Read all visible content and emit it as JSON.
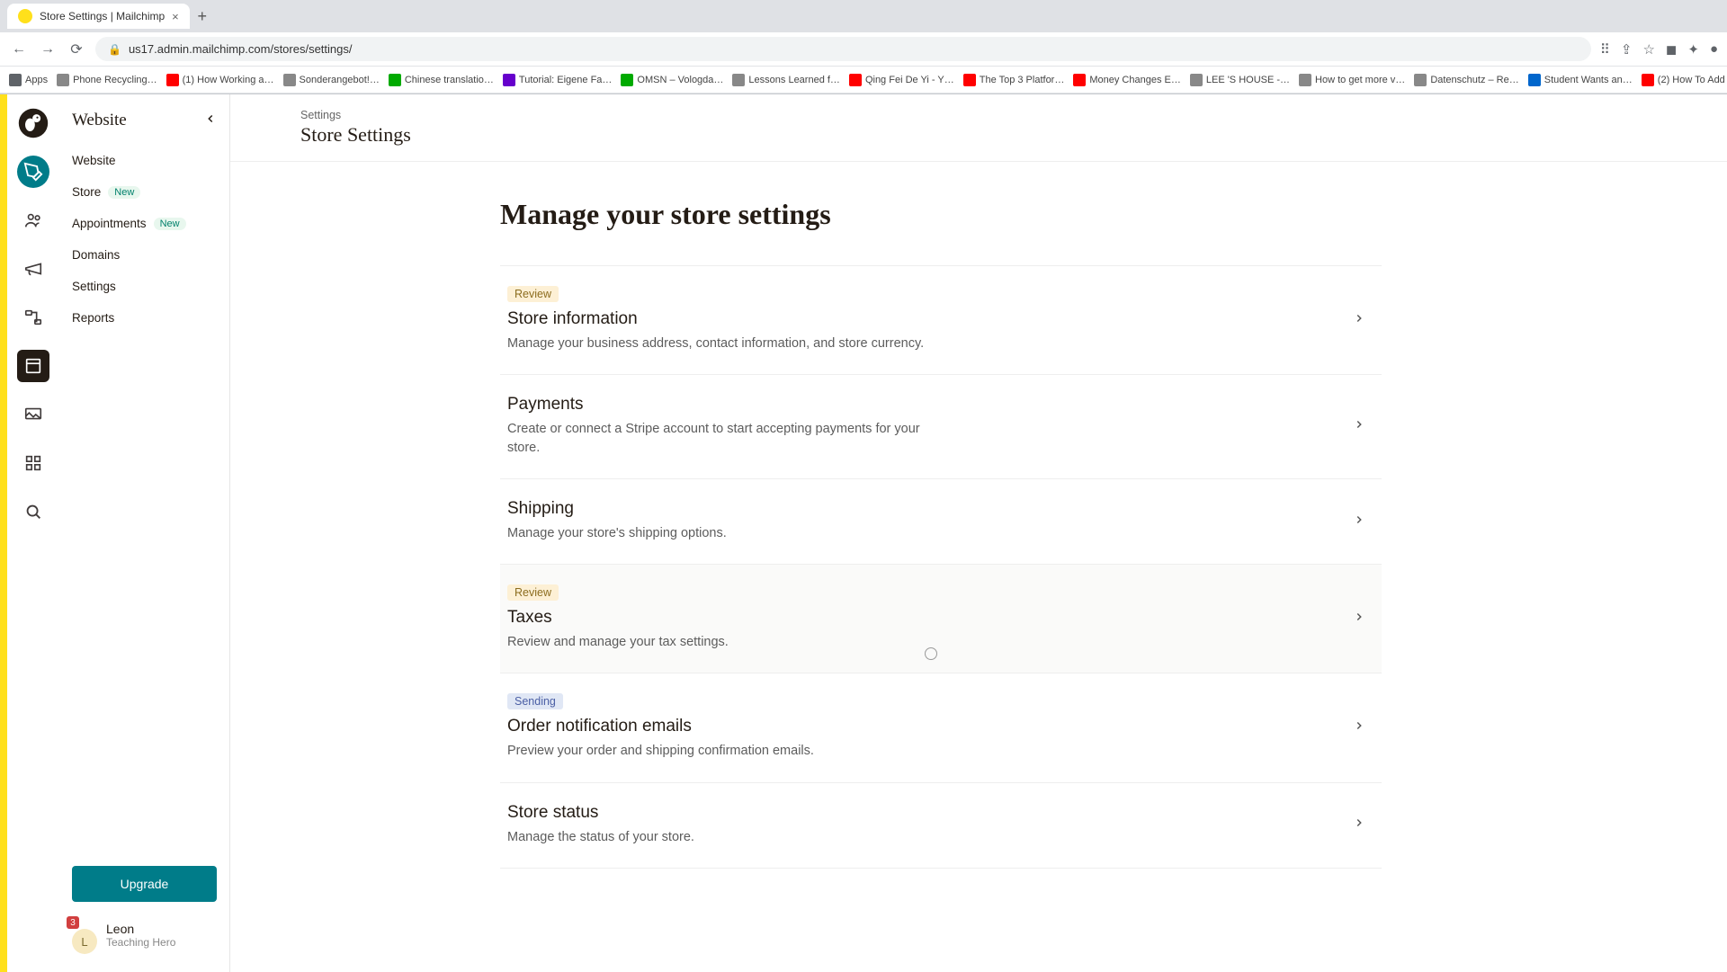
{
  "browser": {
    "tab_title": "Store Settings | Mailchimp",
    "url": "us17.admin.mailchimp.com/stores/settings/",
    "bookmarks": [
      {
        "label": "Apps",
        "icon": "apps"
      },
      {
        "label": "Phone Recycling…",
        "icon": "g"
      },
      {
        "label": "(1) How Working a…",
        "icon": "red"
      },
      {
        "label": "Sonderangebot!…",
        "icon": "g"
      },
      {
        "label": "Chinese translatio…",
        "icon": "grn"
      },
      {
        "label": "Tutorial: Eigene Fa…",
        "icon": "pur"
      },
      {
        "label": "OMSN – Vologda…",
        "icon": "grn"
      },
      {
        "label": "Lessons Learned f…",
        "icon": "g"
      },
      {
        "label": "Qing Fei De Yi - Y…",
        "icon": "red"
      },
      {
        "label": "The Top 3 Platfor…",
        "icon": "red"
      },
      {
        "label": "Money Changes E…",
        "icon": "red"
      },
      {
        "label": "LEE 'S HOUSE -…",
        "icon": "g"
      },
      {
        "label": "How to get more v…",
        "icon": "g"
      },
      {
        "label": "Datenschutz – Re…",
        "icon": "g"
      },
      {
        "label": "Student Wants an…",
        "icon": "blu"
      },
      {
        "label": "(2) How To Add A…",
        "icon": "red"
      }
    ]
  },
  "sidebar": {
    "title": "Website",
    "items": [
      {
        "label": "Website",
        "badge": ""
      },
      {
        "label": "Store",
        "badge": "New"
      },
      {
        "label": "Appointments",
        "badge": "New"
      },
      {
        "label": "Domains",
        "badge": ""
      },
      {
        "label": "Settings",
        "badge": ""
      },
      {
        "label": "Reports",
        "badge": ""
      }
    ],
    "upgrade": "Upgrade",
    "user": {
      "name": "Leon",
      "org": "Teaching Hero",
      "badge": "3",
      "initial": "L"
    }
  },
  "header": {
    "crumb": "Settings",
    "title": "Store Settings"
  },
  "page": {
    "heading": "Manage your store settings",
    "cards": [
      {
        "tag": "Review",
        "tagClass": "tag-review",
        "title": "Store information",
        "desc": "Manage your business address, contact information, and store currency."
      },
      {
        "tag": "",
        "tagClass": "",
        "title": "Payments",
        "desc": "Create or connect a Stripe account to start accepting payments for your store."
      },
      {
        "tag": "",
        "tagClass": "",
        "title": "Shipping",
        "desc": "Manage your store's shipping options."
      },
      {
        "tag": "Review",
        "tagClass": "tag-review",
        "title": "Taxes",
        "desc": "Review and manage your tax settings.",
        "hover": true
      },
      {
        "tag": "Sending",
        "tagClass": "tag-sending",
        "title": "Order notification emails",
        "desc": "Preview your order and shipping confirmation emails."
      },
      {
        "tag": "",
        "tagClass": "",
        "title": "Store status",
        "desc": "Manage the status of your store."
      }
    ]
  }
}
